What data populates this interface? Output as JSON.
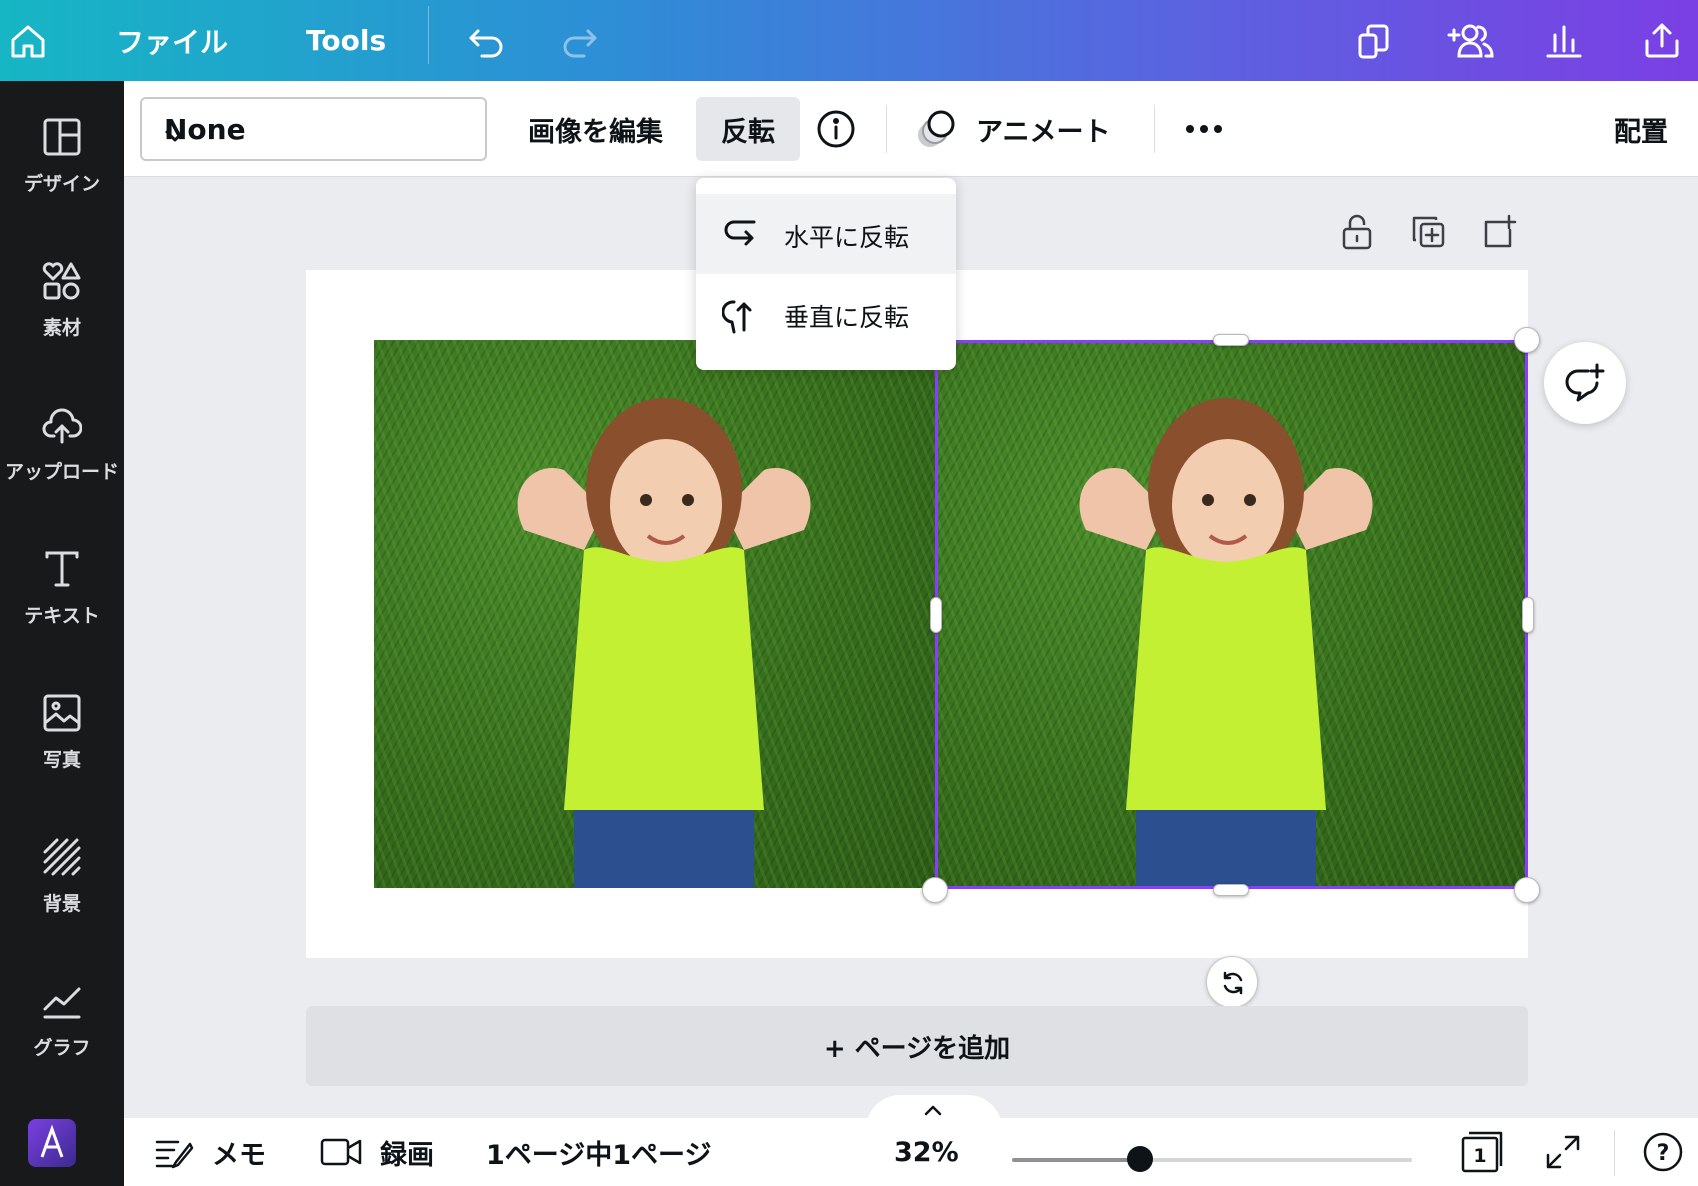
{
  "topbar": {
    "file_label": "ファイル",
    "tools_label": "Tools",
    "gradient_colors": [
      "#16b6c4",
      "#5b63e0",
      "#7b3fe4"
    ],
    "icons": [
      "home-icon",
      "undo-icon",
      "redo-icon",
      "copy-design-icon",
      "share-people-icon",
      "insights-icon",
      "upload-share-icon"
    ]
  },
  "sidebar": {
    "items": [
      {
        "label": "デザイン",
        "icon": "layout-icon"
      },
      {
        "label": "素材",
        "icon": "elements-icon"
      },
      {
        "label": "アップロード",
        "icon": "cloud-upload-icon"
      },
      {
        "label": "テキスト",
        "icon": "text-icon"
      },
      {
        "label": "写真",
        "icon": "photo-icon"
      },
      {
        "label": "背景",
        "icon": "background-icon"
      },
      {
        "label": "グラフ",
        "icon": "chart-icon"
      },
      {
        "label": "",
        "icon": "app-icon"
      }
    ]
  },
  "toolbar": {
    "filter_value": "None",
    "edit_image_label": "画像を編集",
    "flip_label": "反転",
    "animate_label": "アニメート",
    "position_label": "配置"
  },
  "flip_menu": {
    "horizontal_label": "水平に反転",
    "vertical_label": "垂直に反転"
  },
  "canvas": {
    "add_page_label": "+ ページを追加",
    "selection_color": "#8b3dff"
  },
  "bottombar": {
    "notes_label": "メモ",
    "record_label": "録画",
    "page_info": "1ページ中1ページ",
    "zoom": "32%",
    "zoom_level": 0.32,
    "page_count": "1",
    "help": "?"
  }
}
